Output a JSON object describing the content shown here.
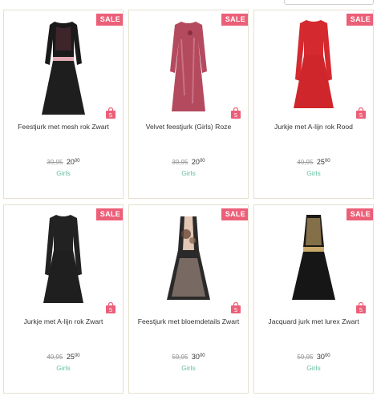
{
  "badge": "SALE",
  "products": [
    {
      "title": "Feestjurk met mesh rok Zwart",
      "old_price": "39,95",
      "price_main": "20",
      "price_cents": "00",
      "category": "Girls",
      "colors": {
        "top": "#1a1a1a",
        "skirt": "#1e1e1e",
        "accent": "#e0a8b2"
      }
    },
    {
      "title": "Velvet feestjurk (Girls) Roze",
      "old_price": "39,95",
      "price_main": "20",
      "price_cents": "00",
      "category": "Girls",
      "colors": {
        "top": "#b44a5e",
        "skirt": "#c05a6e",
        "accent": "#d98a99"
      }
    },
    {
      "title": "Jurkje met A-lijn rok Rood",
      "old_price": "49,95",
      "price_main": "25",
      "price_cents": "00",
      "category": "Girls",
      "colors": {
        "top": "#d42a2f",
        "skirt": "#d42a2f",
        "accent": "#d42a2f"
      }
    },
    {
      "title": "Jurkje met A-lijn rok Zwart",
      "old_price": "49,95",
      "price_main": "25",
      "price_cents": "00",
      "category": "Girls",
      "colors": {
        "top": "#222222",
        "skirt": "#222222",
        "accent": "#222222"
      }
    },
    {
      "title": "Feestjurk met bloemdetails Zwart",
      "old_price": "59,95",
      "price_main": "30",
      "price_cents": "00",
      "category": "Girls",
      "colors": {
        "top": "#2a2a2a",
        "skirt": "#2b2a2a",
        "accent": "#e2c7b4"
      }
    },
    {
      "title": "Jacquard jurk met lurex Zwart",
      "old_price": "59,95",
      "price_main": "30",
      "price_cents": "00",
      "category": "Girls",
      "colors": {
        "top": "#1d1a16",
        "skirt": "#161616",
        "accent": "#c8a96a"
      }
    }
  ]
}
